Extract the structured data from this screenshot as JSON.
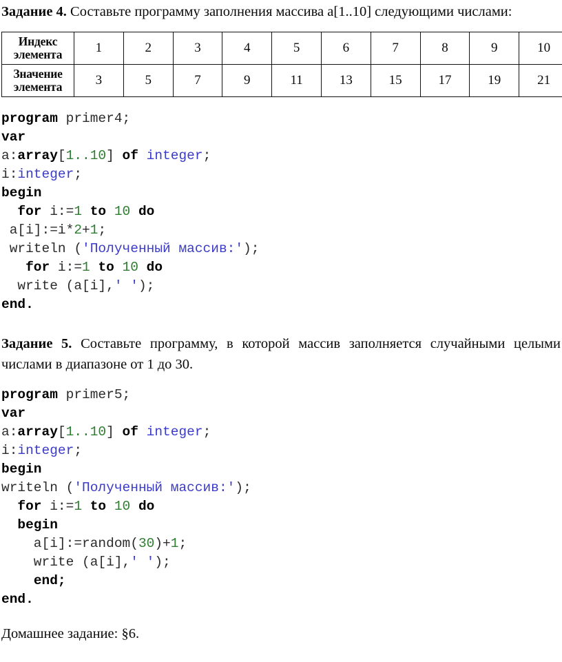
{
  "document": {
    "language": "ru"
  },
  "task4": {
    "label": "Задание 4.",
    "text": "Составьте программу заполнения массива a[1..10] следующими числами:"
  },
  "array_table": {
    "row_headers": [
      "Индекс элемента",
      "Значение элемента"
    ],
    "index_header_line1": "Индекс",
    "index_header_line2": "элемента",
    "value_header_line1": "Значение",
    "value_header_line2": "элемента",
    "indices": [
      "1",
      "2",
      "3",
      "4",
      "5",
      "6",
      "7",
      "8",
      "9",
      "10"
    ],
    "values": [
      "3",
      "5",
      "7",
      "9",
      "11",
      "13",
      "15",
      "17",
      "19",
      "21"
    ]
  },
  "code_primer4": {
    "name": "primer4",
    "lines": [
      [
        {
          "t": "program",
          "c": "kw"
        },
        {
          "t": " primer4;",
          "c": "pl"
        }
      ],
      [
        {
          "t": "var",
          "c": "kw"
        }
      ],
      [
        {
          "t": "a:",
          "c": "pl"
        },
        {
          "t": "array",
          "c": "kw"
        },
        {
          "t": "[",
          "c": "pl"
        },
        {
          "t": "1..10",
          "c": "num"
        },
        {
          "t": "] ",
          "c": "pl"
        },
        {
          "t": "of",
          "c": "kw"
        },
        {
          "t": " ",
          "c": "pl"
        },
        {
          "t": "integer",
          "c": "typ"
        },
        {
          "t": ";",
          "c": "pl"
        }
      ],
      [
        {
          "t": "i:",
          "c": "pl"
        },
        {
          "t": "integer",
          "c": "typ"
        },
        {
          "t": ";",
          "c": "pl"
        }
      ],
      [
        {
          "t": "begin",
          "c": "kw"
        }
      ],
      [
        {
          "t": "  ",
          "c": "pl"
        },
        {
          "t": "for",
          "c": "kw"
        },
        {
          "t": " i:=",
          "c": "pl"
        },
        {
          "t": "1",
          "c": "num"
        },
        {
          "t": " ",
          "c": "pl"
        },
        {
          "t": "to",
          "c": "kw"
        },
        {
          "t": " ",
          "c": "pl"
        },
        {
          "t": "10",
          "c": "num"
        },
        {
          "t": " ",
          "c": "pl"
        },
        {
          "t": "do",
          "c": "kw"
        }
      ],
      [
        {
          "t": " a[i]:=i*",
          "c": "pl"
        },
        {
          "t": "2",
          "c": "num"
        },
        {
          "t": "+",
          "c": "pl"
        },
        {
          "t": "1",
          "c": "num"
        },
        {
          "t": ";",
          "c": "pl"
        }
      ],
      [
        {
          "t": " writeln (",
          "c": "pl"
        },
        {
          "t": "'Полученный массив:'",
          "c": "str"
        },
        {
          "t": ");",
          "c": "pl"
        }
      ],
      [
        {
          "t": "   ",
          "c": "pl"
        },
        {
          "t": "for",
          "c": "kw"
        },
        {
          "t": " i:=",
          "c": "pl"
        },
        {
          "t": "1",
          "c": "num"
        },
        {
          "t": " ",
          "c": "pl"
        },
        {
          "t": "to",
          "c": "kw"
        },
        {
          "t": " ",
          "c": "pl"
        },
        {
          "t": "10",
          "c": "num"
        },
        {
          "t": " ",
          "c": "pl"
        },
        {
          "t": "do",
          "c": "kw"
        }
      ],
      [
        {
          "t": "  write (a[i],",
          "c": "pl"
        },
        {
          "t": "' '",
          "c": "str"
        },
        {
          "t": ");",
          "c": "pl"
        }
      ],
      [
        {
          "t": "end.",
          "c": "kw"
        }
      ]
    ]
  },
  "task5": {
    "label": "Задание 5.",
    "text": "Составьте программу, в которой массив заполняется случайными целыми числами в диапазоне от 1 до 30."
  },
  "code_primer5": {
    "name": "primer5",
    "lines": [
      [
        {
          "t": "program",
          "c": "kw"
        },
        {
          "t": " primer5;",
          "c": "pl"
        }
      ],
      [
        {
          "t": "var",
          "c": "kw"
        }
      ],
      [
        {
          "t": "a:",
          "c": "pl"
        },
        {
          "t": "array",
          "c": "kw"
        },
        {
          "t": "[",
          "c": "pl"
        },
        {
          "t": "1..10",
          "c": "num"
        },
        {
          "t": "] ",
          "c": "pl"
        },
        {
          "t": "of",
          "c": "kw"
        },
        {
          "t": " ",
          "c": "pl"
        },
        {
          "t": "integer",
          "c": "typ"
        },
        {
          "t": ";",
          "c": "pl"
        }
      ],
      [
        {
          "t": "i:",
          "c": "pl"
        },
        {
          "t": "integer",
          "c": "typ"
        },
        {
          "t": ";",
          "c": "pl"
        }
      ],
      [
        {
          "t": "begin",
          "c": "kw"
        }
      ],
      [
        {
          "t": "writeln (",
          "c": "pl"
        },
        {
          "t": "'Полученный массив:'",
          "c": "str"
        },
        {
          "t": ");",
          "c": "pl"
        }
      ],
      [
        {
          "t": "  ",
          "c": "pl"
        },
        {
          "t": "for",
          "c": "kw"
        },
        {
          "t": " i:=",
          "c": "pl"
        },
        {
          "t": "1",
          "c": "num"
        },
        {
          "t": " ",
          "c": "pl"
        },
        {
          "t": "to",
          "c": "kw"
        },
        {
          "t": " ",
          "c": "pl"
        },
        {
          "t": "10",
          "c": "num"
        },
        {
          "t": " ",
          "c": "pl"
        },
        {
          "t": "do",
          "c": "kw"
        }
      ],
      [
        {
          "t": "  ",
          "c": "pl"
        },
        {
          "t": "begin",
          "c": "kw"
        }
      ],
      [
        {
          "t": "    a[i]:=random(",
          "c": "pl"
        },
        {
          "t": "30",
          "c": "num"
        },
        {
          "t": ")+",
          "c": "pl"
        },
        {
          "t": "1",
          "c": "num"
        },
        {
          "t": ";",
          "c": "pl"
        }
      ],
      [
        {
          "t": "    write (a[i],",
          "c": "pl"
        },
        {
          "t": "' '",
          "c": "str"
        },
        {
          "t": ");",
          "c": "pl"
        }
      ],
      [
        {
          "t": "    ",
          "c": "pl"
        },
        {
          "t": "end;",
          "c": "kw"
        }
      ],
      [
        {
          "t": "end.",
          "c": "kw"
        }
      ]
    ]
  },
  "homework": {
    "text": "Домашнее задание: §6."
  },
  "colors": {
    "keyword": "#000000",
    "number": "#2f7d32",
    "type": "#3b3bc8",
    "string": "#3b3bc8",
    "plain": "#2b2b2b",
    "border": "#111111"
  }
}
